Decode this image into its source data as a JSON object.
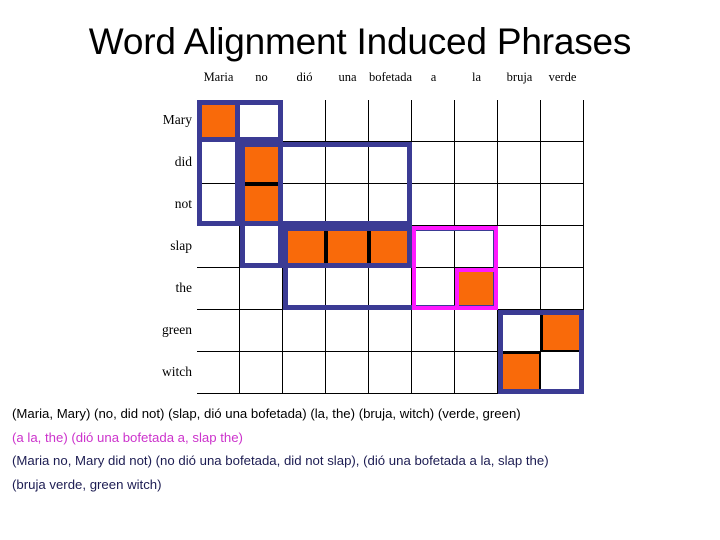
{
  "title": "Word Alignment Induced Phrases",
  "matrix": {
    "source_words": [
      "Maria",
      "no",
      "dió",
      "una",
      "bofetada",
      "a",
      "la",
      "bruja",
      "verde"
    ],
    "target_words": [
      "Mary",
      "did",
      "not",
      "slap",
      "the",
      "green",
      "witch"
    ],
    "alignments": [
      {
        "row": 0,
        "col": 0,
        "source": "Maria",
        "target": "Mary"
      },
      {
        "row": 1,
        "col": 1,
        "source": "no",
        "target": "did"
      },
      {
        "row": 2,
        "col": 1,
        "source": "no",
        "target": "not"
      },
      {
        "row": 3,
        "col": 2,
        "source": "dió",
        "target": "slap"
      },
      {
        "row": 3,
        "col": 3,
        "source": "una",
        "target": "slap"
      },
      {
        "row": 3,
        "col": 4,
        "source": "bofetada",
        "target": "slap"
      },
      {
        "row": 4,
        "col": 6,
        "source": "la",
        "target": "the"
      },
      {
        "row": 5,
        "col": 8,
        "source": "verde",
        "target": "green"
      },
      {
        "row": 6,
        "col": 7,
        "source": "bruja",
        "target": "witch"
      }
    ],
    "phrase_boxes": [
      {
        "color": "blue",
        "row0": 0,
        "row1": 0,
        "col0": 0,
        "col1": 1,
        "label": "Maria / Mary"
      },
      {
        "color": "blue",
        "row0": 0,
        "row1": 2,
        "col0": 0,
        "col1": 0,
        "label": "Maria / Mary did not"
      },
      {
        "color": "blue",
        "row0": 1,
        "row1": 3,
        "col0": 1,
        "col1": 1,
        "label": "no / did not slap"
      },
      {
        "color": "blue",
        "row0": 1,
        "row1": 2,
        "col0": 1,
        "col1": 4,
        "label": "no dió una bofetada / did not"
      },
      {
        "color": "blue",
        "row0": 3,
        "row1": 3,
        "col0": 2,
        "col1": 4,
        "label": "dió una bofetada / slap"
      },
      {
        "color": "blue",
        "row0": 3,
        "row1": 4,
        "col0": 2,
        "col1": 6,
        "label": "dió una bofetada a la / slap the"
      },
      {
        "color": "magenta",
        "row0": 3,
        "row1": 4,
        "col0": 5,
        "col1": 6,
        "label": "a la / the"
      },
      {
        "color": "magenta",
        "row0": 4,
        "row1": 4,
        "col0": 6,
        "col1": 6,
        "label": "la / the"
      },
      {
        "color": "blue",
        "row0": 5,
        "row1": 6,
        "col0": 7,
        "col1": 8,
        "label": "bruja verde / green witch"
      }
    ],
    "colors": {
      "alignment_cell": "#f96a0a",
      "grid_line": "#000000",
      "phrase_box_blue": "#3b3b94",
      "phrase_box_magenta": "#ff18ff"
    }
  },
  "caption": {
    "lines": [
      {
        "text": "(Maria, Mary) (no, did not) (slap, dió una bofetada) (la, the) (bruja, witch) (verde, green)",
        "color": "#000000"
      },
      {
        "text": "(a la, the) (dió una bofetada a, slap the)",
        "color": "#cc33cc"
      },
      {
        "text": "(Maria no, Mary did not) (no dió una bofetada, did not slap), (dió una bofetada a la, slap the)",
        "color": "#1c1c52"
      },
      {
        "text": "(bruja verde, green witch)",
        "color": "#1c1c52"
      }
    ]
  }
}
